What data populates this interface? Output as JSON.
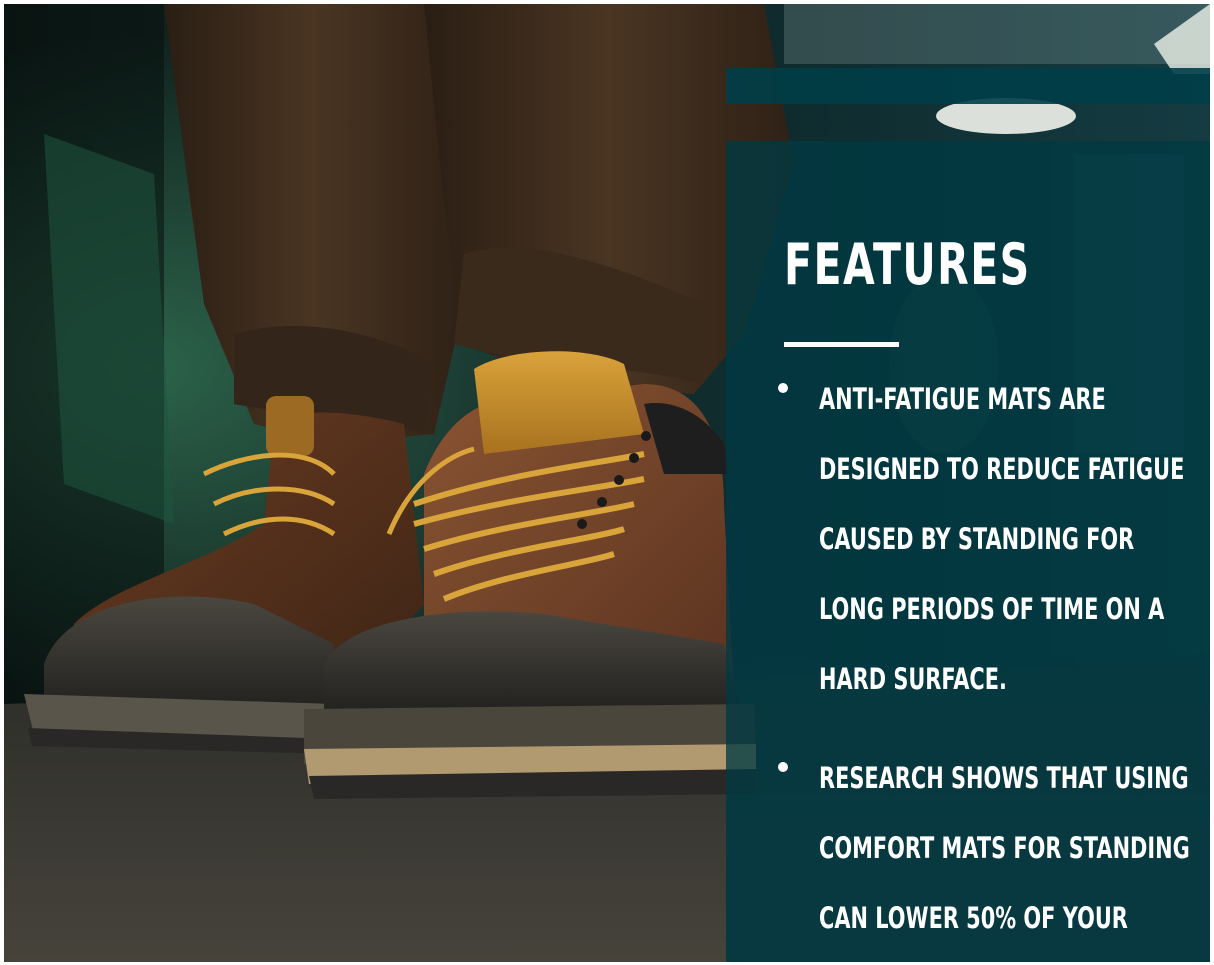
{
  "hero": {
    "image_subject": "worn brown leather work boots with yellow laces standing on a concrete floor",
    "colors": {
      "panel": "#003a42",
      "panel_strip": "#003e48",
      "text": "#ffffff",
      "boot_leather": "#6e3f22",
      "boot_collar": "#c98e2c",
      "laces": "#d9a53a",
      "sole": "#2a2826",
      "floor": "#3a3934"
    }
  },
  "panel": {
    "title": "FEATURES",
    "bullets": [
      "ANTI-FATIGUE MATS ARE DESIGNED TO REDUCE FATIGUE CAUSED BY STANDING FOR LONG PERIODS OF TIME ON A HARD SURFACE.",
      "RESEARCH SHOWS THAT USING COMFORT MATS FOR STANDING CAN LOWER 50% OF YOUR"
    ]
  }
}
